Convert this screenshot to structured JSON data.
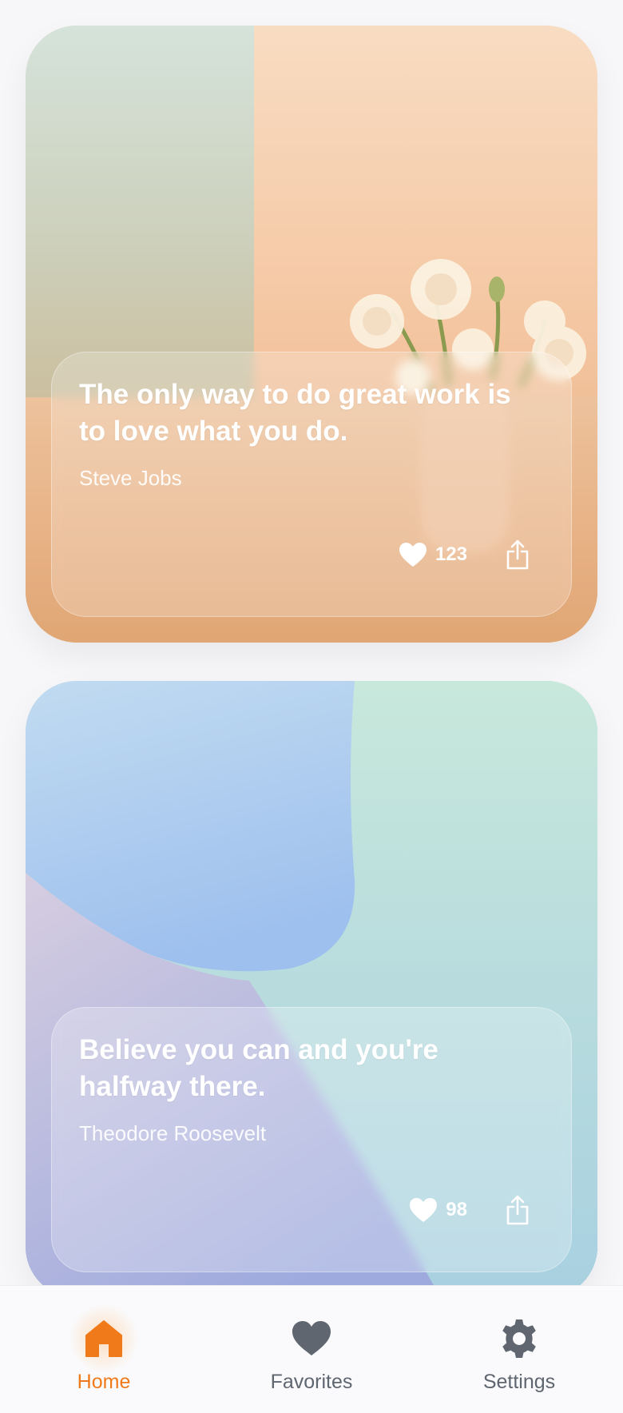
{
  "quotes": [
    {
      "text": "The only way to do great work is to love what you do.",
      "author": "Steve Jobs",
      "likes": "123",
      "like_icon": "heart-icon",
      "share_icon": "share-icon"
    },
    {
      "text": "Believe you can and you're halfway there.",
      "author": "Theodore Roosevelt",
      "likes": "98",
      "like_icon": "heart-icon",
      "share_icon": "share-icon"
    }
  ],
  "nav": {
    "items": [
      {
        "label": "Home",
        "icon": "home-icon",
        "active": true
      },
      {
        "label": "Favorites",
        "icon": "heart-icon",
        "active": false
      },
      {
        "label": "Settings",
        "icon": "gear-icon",
        "active": false
      }
    ]
  },
  "colors": {
    "accent": "#f07a1a",
    "nav_inactive": "#5f6670",
    "text_on_glass": "#ffffff"
  }
}
